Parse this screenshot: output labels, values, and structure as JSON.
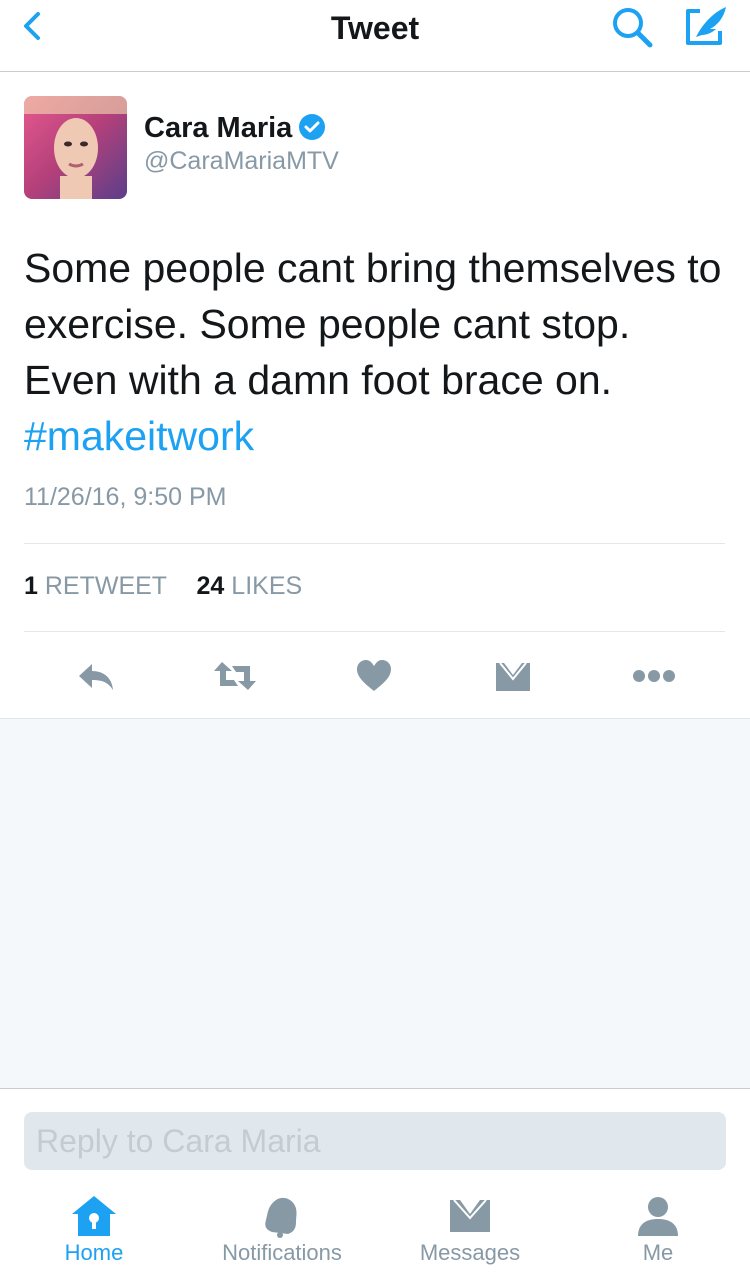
{
  "header": {
    "title": "Tweet"
  },
  "tweet": {
    "author_name": "Cara Maria",
    "author_handle": "@CaraMariaMTV",
    "text_lines": [
      "Some people cant bring themselves to",
      "exercise. Some people cant stop.",
      "Even with a damn foot brace on."
    ],
    "hashtag": "#makeitwork",
    "timestamp": "11/26/16, 9:50 PM",
    "retweet_count": "1",
    "retweet_label": "RETWEET",
    "like_count": "24",
    "like_label": "LIKES"
  },
  "reply": {
    "placeholder": "Reply to Cara Maria"
  },
  "tabs": [
    {
      "label": "Home",
      "icon": "home-icon",
      "active": true
    },
    {
      "label": "Notifications",
      "icon": "bell-icon",
      "active": false
    },
    {
      "label": "Messages",
      "icon": "envelope-icon",
      "active": false
    },
    {
      "label": "Me",
      "icon": "person-icon",
      "active": false
    }
  ],
  "colors": {
    "accent": "#1da1f2",
    "icon_gray": "#8899a6",
    "text": "#14171a"
  }
}
